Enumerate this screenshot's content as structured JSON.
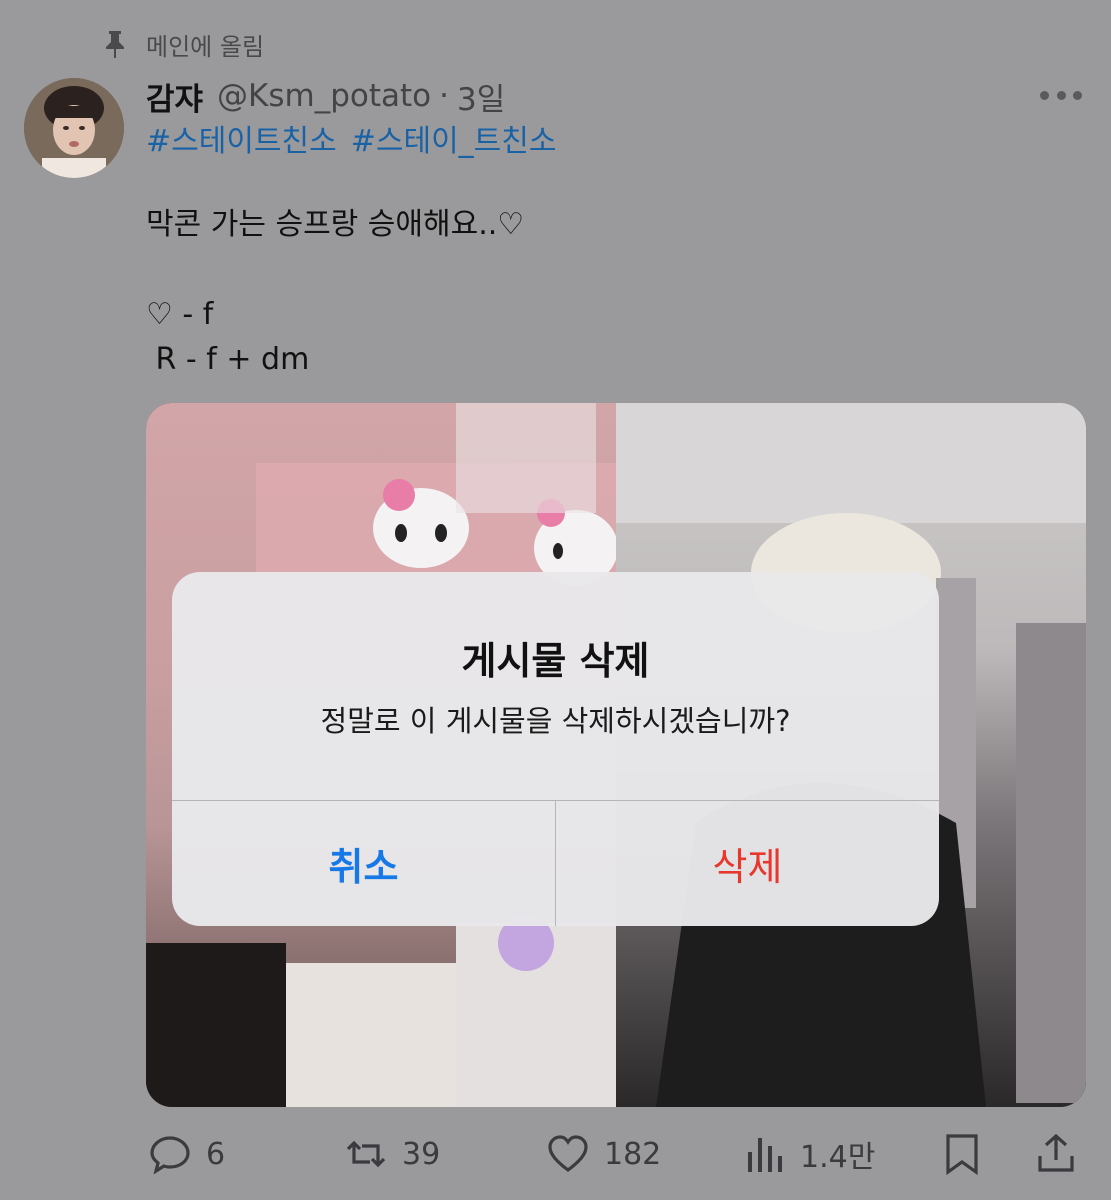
{
  "pinned": {
    "label": "메인에 올림",
    "icon": "pin-icon"
  },
  "tweet": {
    "author_name": "감쟈",
    "handle": "@Ksm_potato",
    "separator": "·",
    "time": "3일",
    "hashtags": [
      "#스테이트친소",
      "#스테이_트친소"
    ],
    "lines": [
      "막콘 가는 승프랑 승애해요..♡",
      "",
      "♡ - f",
      " R - f + dm"
    ]
  },
  "alert": {
    "title": "게시물 삭제",
    "message": "정말로 이 게시물을 삭제하시겠습니까?",
    "cancel_label": "취소",
    "delete_label": "삭제",
    "cancel_color": "#1778e8",
    "delete_color": "#e8372c"
  },
  "actions": {
    "replies": "6",
    "retweets": "39",
    "likes": "182",
    "views": "1.4만"
  },
  "colors": {
    "hashtag": "#1a62a6",
    "background_dim": "#9a9a9c"
  }
}
